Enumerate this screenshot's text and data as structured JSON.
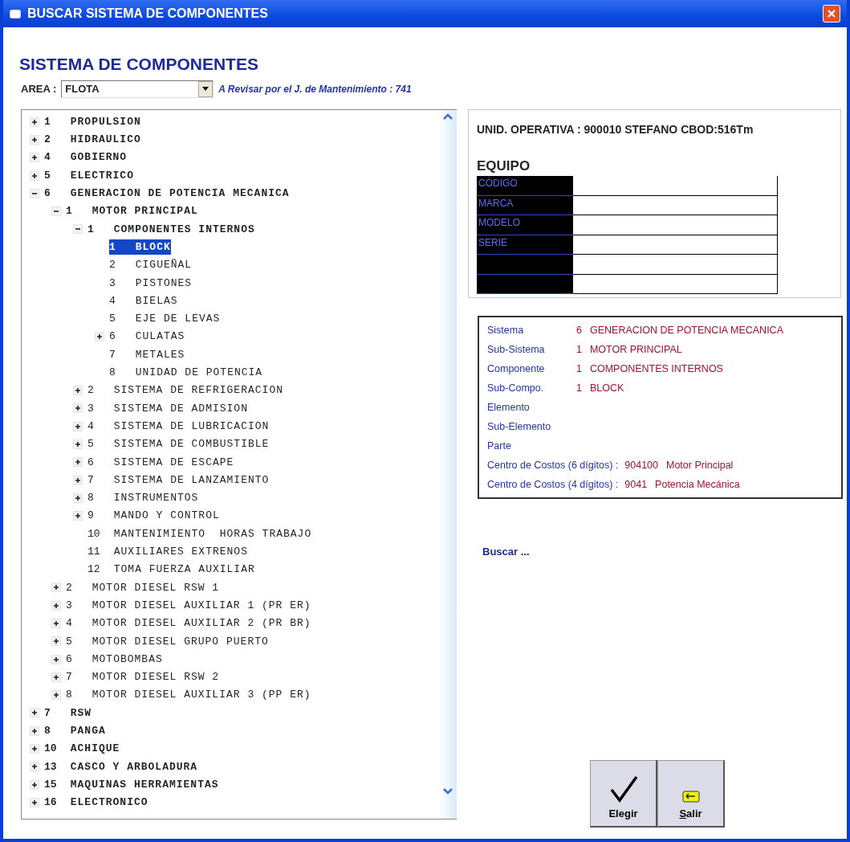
{
  "window": {
    "title": "BUSCAR SISTEMA DE COMPONENTES"
  },
  "heading": "SISTEMA DE COMPONENTES",
  "area": {
    "label": "AREA :",
    "value": "FLOTA"
  },
  "review_note": "A Revisar por el J. de Mantenimiento : 741",
  "tree": [
    {
      "code": "1",
      "label": "PROPULSION",
      "expanded": false,
      "selected": false
    },
    {
      "code": "2",
      "label": "HIDRAULICO",
      "expanded": false,
      "selected": false
    },
    {
      "code": "4",
      "label": "GOBIERNO",
      "expanded": false,
      "selected": false
    },
    {
      "code": "5",
      "label": "ELECTRICO",
      "expanded": false,
      "selected": false
    },
    {
      "code": "6",
      "label": "GENERACION DE POTENCIA MECANICA",
      "expanded": true,
      "selected": false,
      "children": [
        {
          "code": "1",
          "label": "MOTOR PRINCIPAL",
          "expanded": true,
          "selected": false,
          "children": [
            {
              "code": "1",
              "label": "COMPONENTES INTERNOS",
              "expanded": true,
              "selected": false,
              "children": [
                {
                  "code": "1",
                  "label": "BLOCK",
                  "selected": true
                },
                {
                  "code": "2",
                  "label": "CIGUEÑAL",
                  "selected": false
                },
                {
                  "code": "3",
                  "label": "PISTONES",
                  "selected": false
                },
                {
                  "code": "4",
                  "label": "BIELAS",
                  "selected": false
                },
                {
                  "code": "5",
                  "label": "EJE DE LEVAS",
                  "selected": false
                },
                {
                  "code": "6",
                  "label": "CULATAS",
                  "expanded": false,
                  "selected": false
                },
                {
                  "code": "7",
                  "label": "METALES",
                  "selected": false
                },
                {
                  "code": "8",
                  "label": "UNIDAD DE POTENCIA",
                  "selected": false
                }
              ]
            },
            {
              "code": "2",
              "label": "SISTEMA DE REFRIGERACION",
              "expanded": false,
              "selected": false
            },
            {
              "code": "3",
              "label": "SISTEMA DE ADMISION",
              "expanded": false,
              "selected": false
            },
            {
              "code": "4",
              "label": "SISTEMA DE LUBRICACION",
              "expanded": false,
              "selected": false
            },
            {
              "code": "5",
              "label": "SISTEMA DE COMBUSTIBLE",
              "expanded": false,
              "selected": false
            },
            {
              "code": "6",
              "label": "SISTEMA DE ESCAPE",
              "expanded": false,
              "selected": false
            },
            {
              "code": "7",
              "label": "SISTEMA DE LANZAMIENTO",
              "expanded": false,
              "selected": false
            },
            {
              "code": "8",
              "label": "INSTRUMENTOS",
              "expanded": false,
              "selected": false
            },
            {
              "code": "9",
              "label": "MANDO Y CONTROL",
              "expanded": false,
              "selected": false
            },
            {
              "code": "10",
              "label": "MANTENIMIENTO  HORAS TRABAJO",
              "selected": false
            },
            {
              "code": "11",
              "label": "AUXILIARES EXTRENOS",
              "selected": false
            },
            {
              "code": "12",
              "label": "TOMA FUERZA AUXILIAR",
              "selected": false
            }
          ]
        },
        {
          "code": "2",
          "label": "MOTOR DIESEL RSW 1",
          "expanded": false,
          "selected": false
        },
        {
          "code": "3",
          "label": "MOTOR DIESEL AUXILIAR 1 (PR ER)",
          "expanded": false,
          "selected": false
        },
        {
          "code": "4",
          "label": "MOTOR DIESEL AUXILIAR 2 (PR BR)",
          "expanded": false,
          "selected": false
        },
        {
          "code": "5",
          "label": "MOTOR DIESEL GRUPO PUERTO",
          "expanded": false,
          "selected": false
        },
        {
          "code": "6",
          "label": "MOTOBOMBAS",
          "expanded": false,
          "selected": false
        },
        {
          "code": "7",
          "label": "MOTOR DIESEL RSW 2",
          "expanded": false,
          "selected": false
        },
        {
          "code": "8",
          "label": "MOTOR DIESEL AUXILIAR 3 (PP ER)",
          "expanded": false,
          "selected": false
        }
      ]
    },
    {
      "code": "7",
      "label": "RSW",
      "expanded": false,
      "selected": false
    },
    {
      "code": "8",
      "label": "PANGA",
      "expanded": false,
      "selected": false
    },
    {
      "code": "10",
      "label": "ACHIQUE",
      "expanded": false,
      "selected": false
    },
    {
      "code": "13",
      "label": "CASCO Y ARBOLADURA",
      "expanded": false,
      "selected": false
    },
    {
      "code": "15",
      "label": "MAQUINAS HERRAMIENTAS",
      "expanded": false,
      "selected": false
    },
    {
      "code": "16",
      "label": "ELECTRONICO",
      "expanded": false,
      "selected": false
    }
  ],
  "unit_header": "UNID. OPERATIVA : 900010  STEFANO  CBOD:516Tm",
  "equipo": {
    "title": "EQUIPO",
    "fields": [
      "CÓDIGO",
      "MARCA",
      "MODELO",
      "SERIE"
    ]
  },
  "summary": [
    {
      "label": "Sistema",
      "code": "6",
      "value": "GENERACION DE POTENCIA MECANICA"
    },
    {
      "label": "Sub-Sistema",
      "code": "1",
      "value": "MOTOR PRINCIPAL"
    },
    {
      "label": "Componente",
      "code": "1",
      "value": "COMPONENTES INTERNOS"
    },
    {
      "label": "Sub-Compo.",
      "code": "1",
      "value": "BLOCK"
    },
    {
      "label": "Elemento"
    },
    {
      "label": "Sub-Elemento"
    },
    {
      "label": "Parte"
    }
  ],
  "cost_centers": [
    {
      "label": "Centro de Costos (6 dígitos) :",
      "code": "904100",
      "value": "Motor Principal"
    },
    {
      "label": "Centro de Costos (4 dígitos) :",
      "code": "9041",
      "value": "Potencia Mecánica"
    }
  ],
  "search_link": "Buscar ...",
  "buttons": [
    {
      "kind": "check",
      "label": "Elegir",
      "underline_first": false
    },
    {
      "kind": "exit",
      "label": "Salir",
      "underline_first": true
    }
  ]
}
